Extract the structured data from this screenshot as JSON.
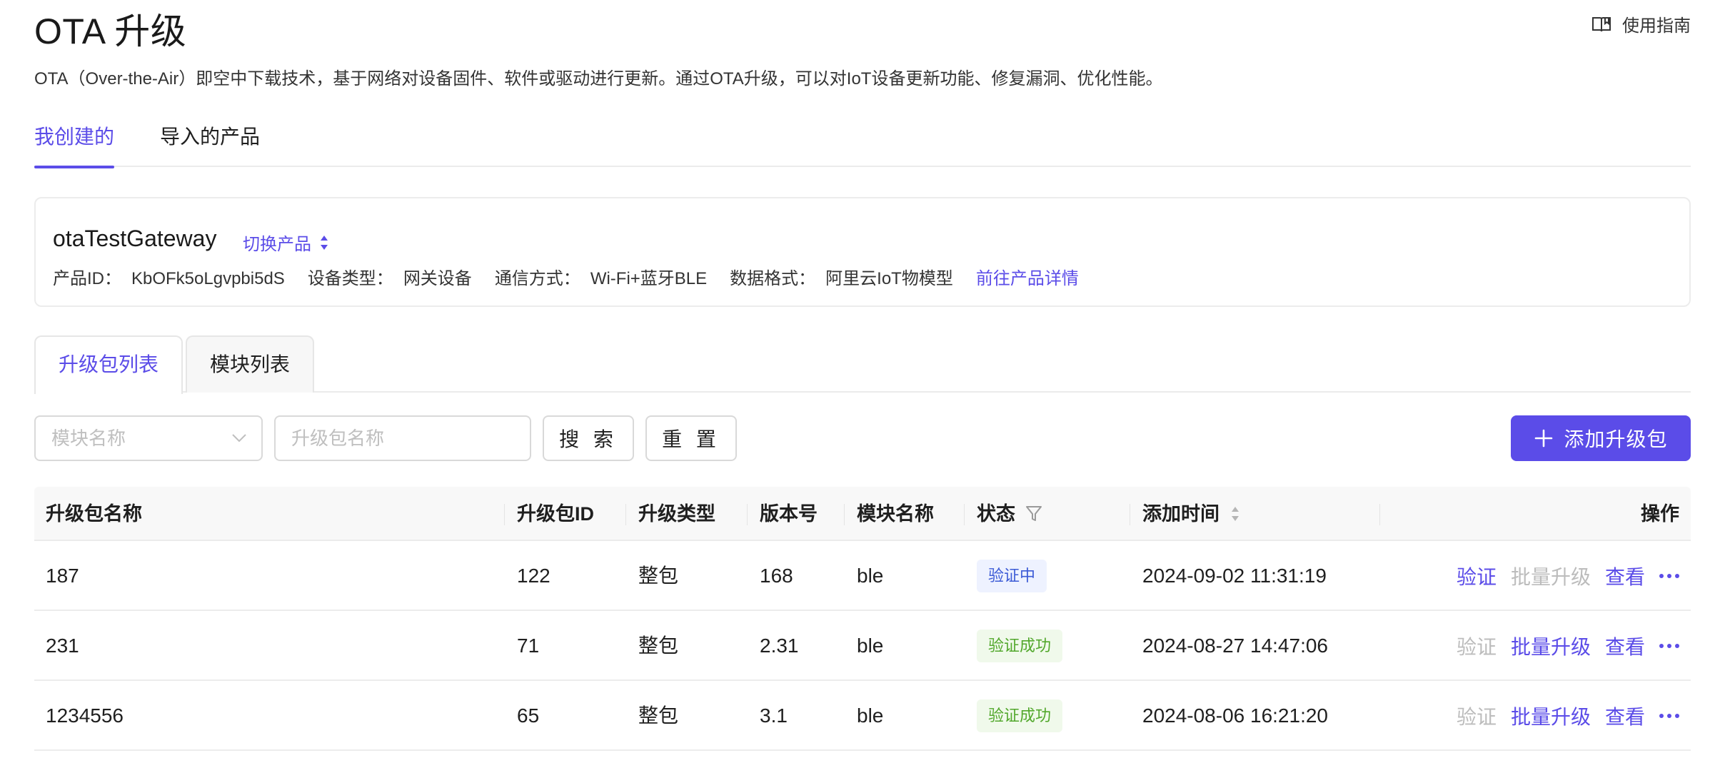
{
  "header": {
    "title": "OTA 升级",
    "guide_label": "使用指南",
    "description": "OTA（Over-the-Air）即空中下载技术，基于网络对设备固件、软件或驱动进行更新。通过OTA升级，可以对IoT设备更新功能、修复漏洞、优化性能。"
  },
  "main_tabs": [
    {
      "label": "我创建的",
      "active": true
    },
    {
      "label": "导入的产品",
      "active": false
    }
  ],
  "product": {
    "name": "otaTestGateway",
    "switch_label": "切换产品",
    "id_label": "产品ID：",
    "id_value": "KbOFk5oLgvpbi5dS",
    "type_label": "设备类型：",
    "type_value": "网关设备",
    "comm_label": "通信方式：",
    "comm_value": "Wi-Fi+蓝牙BLE",
    "format_label": "数据格式：",
    "format_value": "阿里云IoT物模型",
    "detail_link": "前往产品详情"
  },
  "sub_tabs": [
    {
      "label": "升级包列表",
      "active": true
    },
    {
      "label": "模块列表",
      "active": false
    }
  ],
  "filters": {
    "module_placeholder": "模块名称",
    "package_placeholder": "升级包名称",
    "search_label": "搜 索",
    "reset_label": "重 置",
    "add_label": "添加升级包"
  },
  "table": {
    "columns": [
      "升级包名称",
      "升级包ID",
      "升级类型",
      "版本号",
      "模块名称",
      "状态",
      "添加时间",
      "操作"
    ],
    "rows": [
      {
        "name": "187",
        "id": "122",
        "type": "整包",
        "version": "168",
        "module": "ble",
        "status": "验证中",
        "time": "2024-09-02 11:31:19",
        "verify": "验证",
        "batch": "批量升级",
        "view": "查看"
      },
      {
        "name": "231",
        "id": "71",
        "type": "整包",
        "version": "2.31",
        "module": "ble",
        "status": "验证成功",
        "time": "2024-08-27 14:47:06",
        "verify": "验证",
        "batch": "批量升级",
        "view": "查看"
      },
      {
        "name": "1234556",
        "id": "65",
        "type": "整包",
        "version": "3.1",
        "module": "ble",
        "status": "验证成功",
        "time": "2024-08-06 16:21:20",
        "verify": "验证",
        "batch": "批量升级",
        "view": "查看"
      }
    ]
  },
  "colors": {
    "accent": "#5b4ce8",
    "pending_bg": "#eef2ff",
    "pending_text": "#3c5bd6",
    "success_bg": "#f0f9eb",
    "success_text": "#52a82c",
    "disabled_text": "#bcbcbc"
  }
}
